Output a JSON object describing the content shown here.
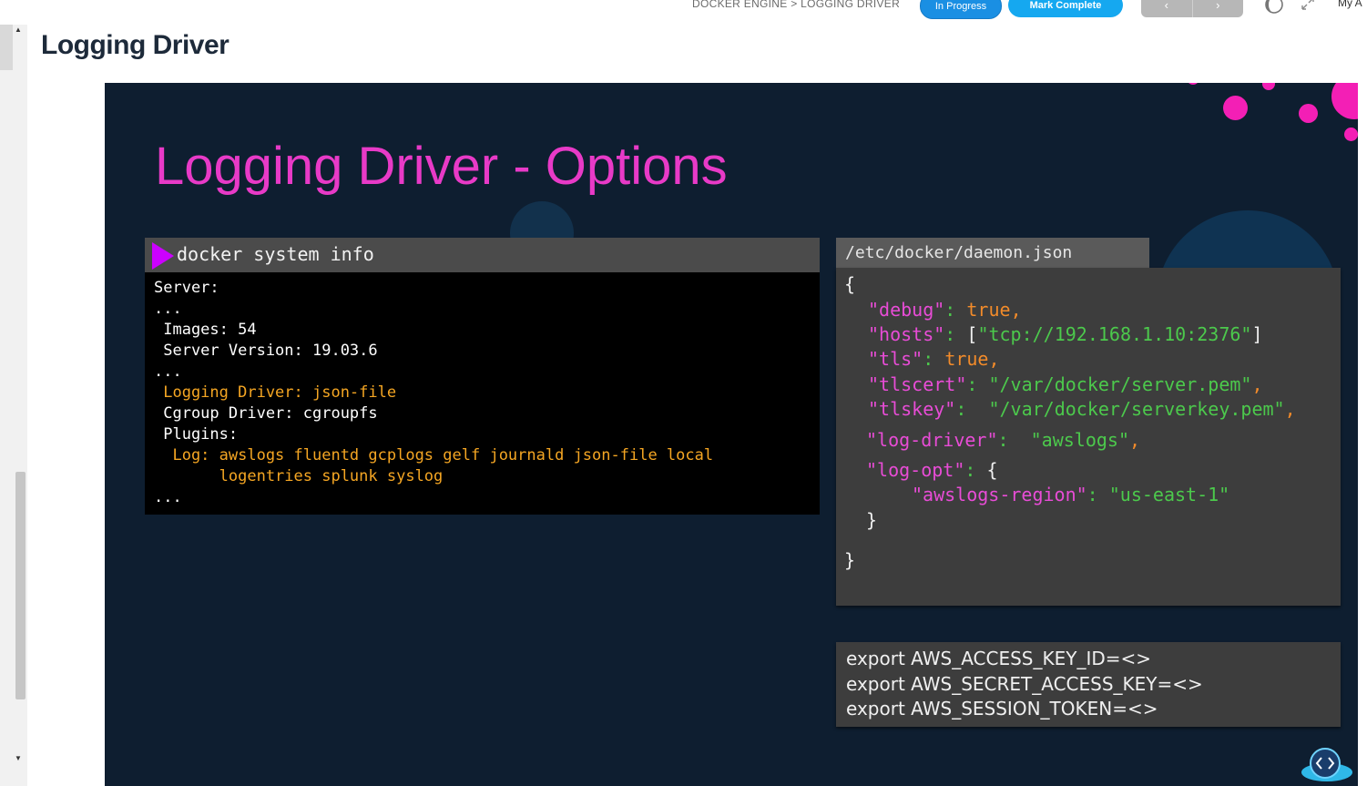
{
  "breadcrumb": "DOCKER ENGINE > LOGGING DRIVER",
  "status_button": "In Progress",
  "complete_button": "Mark Complete",
  "nav": {
    "prev": "‹",
    "next": "›"
  },
  "account_label": "My A",
  "page_title": "Logging Driver",
  "slide": {
    "title": "Logging Driver - Options",
    "terminal": {
      "command": "docker system info",
      "lines": [
        {
          "text": "Server:",
          "color": "white"
        },
        {
          "text": "...",
          "color": "white"
        },
        {
          "text": " Images: 54",
          "color": "white"
        },
        {
          "text": " Server Version: 19.03.6",
          "color": "white"
        },
        {
          "text": "...",
          "color": "white"
        },
        {
          "text": " Logging Driver: json-file",
          "color": "orange"
        },
        {
          "text": " Cgroup Driver: cgroupfs",
          "color": "white"
        },
        {
          "text": " Plugins:",
          "color": "white"
        },
        {
          "text": "  Log: awslogs fluentd gcplogs gelf journald json-file local",
          "color": "orange"
        },
        {
          "text": "       logentries splunk syslog",
          "color": "orange"
        },
        {
          "text": "...",
          "color": "white"
        }
      ]
    },
    "daemon_file": {
      "filename": "/etc/docker/daemon.json",
      "open_brace": "{",
      "debug_key": "\"debug\"",
      "debug_val": "true",
      "hosts_key": "\"hosts\"",
      "hosts_val": "\"tcp://192.168.1.10:2376\"",
      "tls_key": "\"tls\"",
      "tls_val": "true",
      "tlscert_key": "\"tlscert\"",
      "tlscert_val": "\"/var/docker/server.pem\"",
      "tlskey_key": "\"tlskey\"",
      "tlskey_val": "\"/var/docker/serverkey.pem\"",
      "logdriver_key": "\"log-driver\"",
      "logdriver_val": "\"awslogs\"",
      "logopt_key": "\"log-opt\"",
      "region_key": "\"awslogs-region\"",
      "region_val": "\"us-east-1\"",
      "inner_close": "}",
      "close_brace": "}"
    },
    "exports": [
      "export AWS_ACCESS_KEY_ID=<>",
      "export AWS_SECRET_ACCESS_KEY=<>",
      "export AWS_SESSION_TOKEN=<>"
    ]
  },
  "colors": {
    "slide_bg": "#0e1e30",
    "title_pink": "#e83ac7",
    "json_key": "#e84cd6",
    "json_string": "#4cc94c",
    "json_bool": "#f28b2a",
    "terminal_orange": "#f5a623",
    "accent_blue": "#15a8f0"
  },
  "icons": [
    "dark-mode-icon",
    "fullscreen-icon",
    "code-badge-icon",
    "play-prompt-icon"
  ]
}
